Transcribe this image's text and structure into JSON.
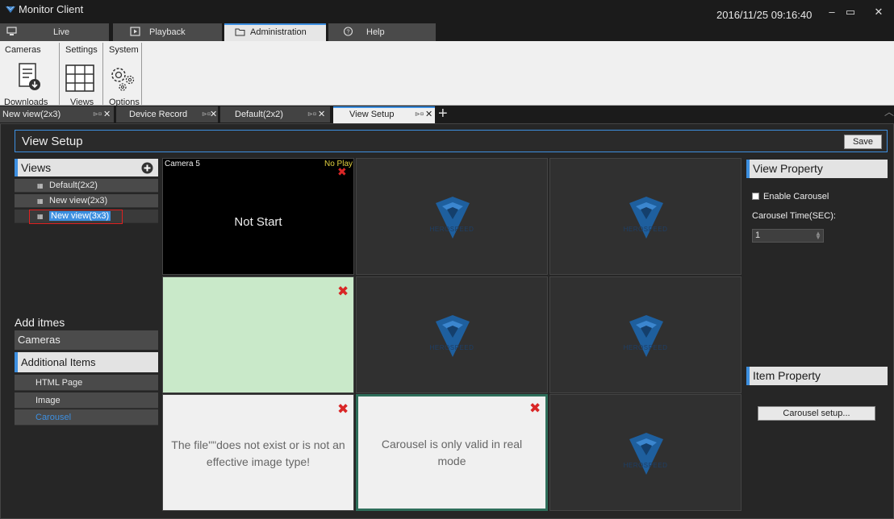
{
  "app": {
    "title": "Monitor Client",
    "datetime": "2016/11/25 09:16:40"
  },
  "main_tabs": [
    {
      "label": "Live",
      "icon": "monitor-icon"
    },
    {
      "label": "Playback",
      "icon": "play-icon"
    },
    {
      "label": "Administration",
      "icon": "folder-icon",
      "active": true
    },
    {
      "label": "Help",
      "icon": "question-icon"
    }
  ],
  "ribbon": {
    "groups": [
      "Cameras",
      "Settings",
      "System"
    ],
    "buttons": [
      {
        "label": "Downloads",
        "icon": "downloads-icon"
      },
      {
        "label": "Views",
        "icon": "grid-view-icon"
      },
      {
        "label": "Options",
        "icon": "gears-icon"
      }
    ]
  },
  "doc_tabs": [
    {
      "label": "New view(2x3)"
    },
    {
      "label": "Device Record"
    },
    {
      "label": "Default(2x2)"
    },
    {
      "label": "View Setup",
      "active": true
    }
  ],
  "view_setup": {
    "title": "View Setup",
    "save_label": "Save"
  },
  "left": {
    "views_title": "Views",
    "views": [
      "Default(2x2)",
      "New view(2x3)",
      "New view(3x3)"
    ],
    "selected_view": "New view(3x3)",
    "add_items_title": "Add itmes",
    "cameras_label": "Cameras",
    "additional_items_label": "Additional Items",
    "additional_items": [
      "HTML Page",
      "Image",
      "Carousel"
    ]
  },
  "grid": {
    "brand": "HEROSPEED",
    "camera_name": "Camera 5",
    "camera_status": "No Play",
    "camera_message": "Not Start",
    "image_error": "The file\"\"does not exist or is not an effective image type!",
    "carousel_message": "Carousel is only valid in real mode"
  },
  "right": {
    "view_property_title": "View Property",
    "enable_carousel_label": "Enable Carousel",
    "enable_carousel_checked": false,
    "carousel_time_label": "Carousel Time(SEC):",
    "carousel_time_value": "1",
    "item_property_title": "Item Property",
    "carousel_setup_label": "Carousel setup..."
  },
  "colors": {
    "accent": "#3d8fe0",
    "close_red": "#d92626",
    "logo_blue": "#1e5f9e",
    "selection_red": "#e02020"
  }
}
